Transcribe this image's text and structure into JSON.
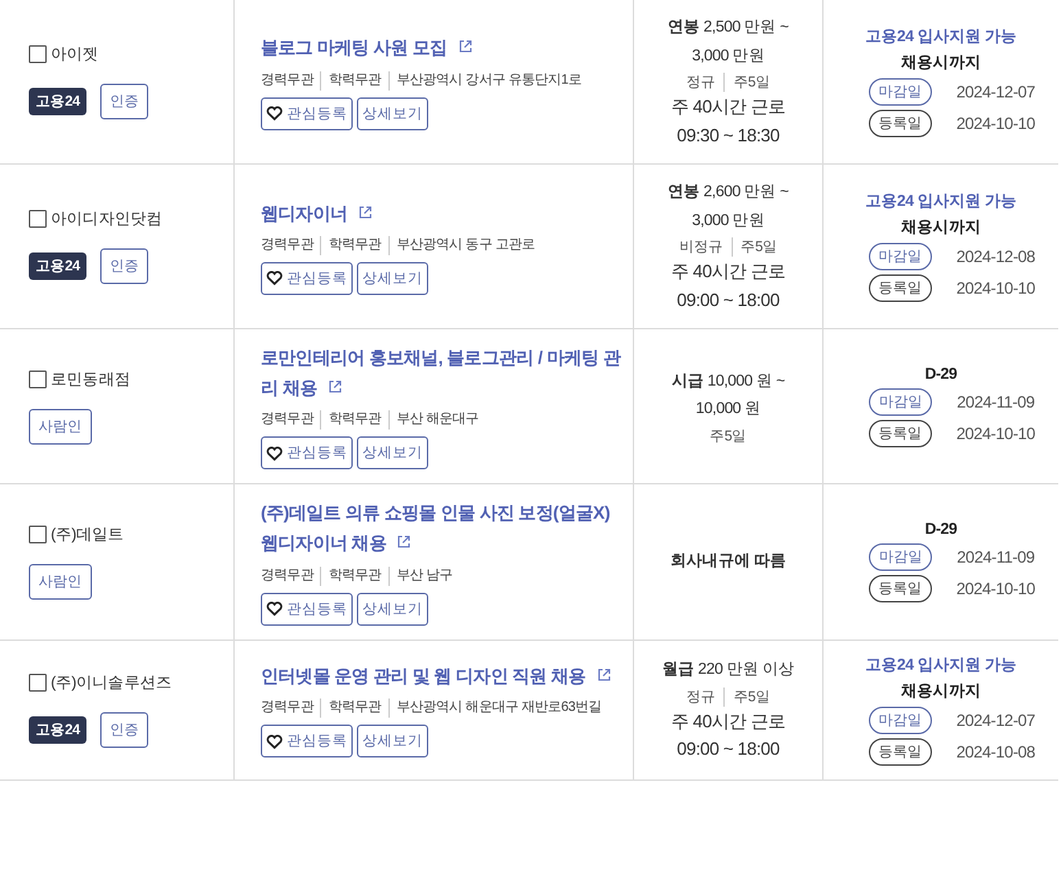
{
  "rows": [
    {
      "company": {
        "name": "아이젯",
        "checked": false
      },
      "badges": [
        {
          "kind": "goyong24",
          "label": "고용24"
        },
        {
          "kind": "outline",
          "label": "인증"
        }
      ],
      "title": "블로그 마케팅 사원 모집",
      "meta": [
        "경력무관",
        "학력무관",
        "부산광역시 강서구 유통단지1로"
      ],
      "buttons": [
        {
          "kind": "favorite",
          "label": "관심등록"
        },
        {
          "kind": "detail",
          "label": "상세보기"
        }
      ],
      "salary": "**연봉** 2,500 만원 ~ 3,000 만원",
      "terms": [
        "정규",
        "주5일"
      ],
      "hours": "주 40시간 근로",
      "time": "09:30 ~ 18:30",
      "apply": "고용24 입사지원 가능",
      "deadline": "채용시까지",
      "dates": [
        {
          "kind": "close",
          "label": "마감일",
          "date": "2024-12-07"
        },
        {
          "kind": "posted",
          "label": "등록일",
          "date": "2024-10-10"
        }
      ]
    },
    {
      "company": {
        "name": "아이디자인닷컴",
        "checked": false
      },
      "badges": [
        {
          "kind": "goyong24",
          "label": "고용24"
        },
        {
          "kind": "outline",
          "label": "인증"
        }
      ],
      "title": "웹디자이너",
      "meta": [
        "경력무관",
        "학력무관",
        "부산광역시 동구 고관로"
      ],
      "buttons": [
        {
          "kind": "favorite",
          "label": "관심등록"
        },
        {
          "kind": "detail",
          "label": "상세보기"
        }
      ],
      "salary": "**연봉** 2,600 만원 ~ 3,000 만원",
      "terms": [
        "비정규",
        "주5일"
      ],
      "hours": "주 40시간 근로",
      "time": "09:00 ~ 18:00",
      "apply": "고용24 입사지원 가능",
      "deadline": "채용시까지",
      "dates": [
        {
          "kind": "close",
          "label": "마감일",
          "date": "2024-12-08"
        },
        {
          "kind": "posted",
          "label": "등록일",
          "date": "2024-10-10"
        }
      ]
    },
    {
      "company": {
        "name": "로민동래점",
        "checked": false
      },
      "badges": [
        {
          "kind": "outline",
          "label": "사람인"
        }
      ],
      "title": "로만인테리어 홍보채널, 블로그관리 / 마케팅 관리 채용",
      "meta": [
        "경력무관",
        "학력무관",
        "부산 해운대구"
      ],
      "buttons": [
        {
          "kind": "favorite",
          "label": "관심등록"
        },
        {
          "kind": "detail",
          "label": "상세보기"
        }
      ],
      "salary": "**시급** 10,000 원 ~ 10,000 원",
      "terms": [
        "주5일"
      ],
      "deadline": "D-29",
      "dates": [
        {
          "kind": "close",
          "label": "마감일",
          "date": "2024-11-09"
        },
        {
          "kind": "posted",
          "label": "등록일",
          "date": "2024-10-10"
        }
      ]
    },
    {
      "company": {
        "name": "(주)데일트",
        "checked": false
      },
      "badges": [
        {
          "kind": "outline",
          "label": "사람인"
        }
      ],
      "title": "(주)데일트 의류 쇼핑몰 인물 사진 보정(얼굴X) 웹디자이너 채용",
      "meta": [
        "경력무관",
        "학력무관",
        "부산 남구"
      ],
      "buttons": [
        {
          "kind": "favorite",
          "label": "관심등록"
        },
        {
          "kind": "detail",
          "label": "상세보기"
        }
      ],
      "salary": "**회사내규에 따름**",
      "deadline": "D-29",
      "dates": [
        {
          "kind": "close",
          "label": "마감일",
          "date": "2024-11-09"
        },
        {
          "kind": "posted",
          "label": "등록일",
          "date": "2024-10-10"
        }
      ]
    },
    {
      "company": {
        "name": "(주)이니솔루션즈",
        "checked": false
      },
      "badges": [
        {
          "kind": "goyong24",
          "label": "고용24"
        },
        {
          "kind": "outline",
          "label": "인증"
        }
      ],
      "title": "인터넷몰 운영 관리 및 웹 디자인 직원 채용",
      "meta": [
        "경력무관",
        "학력무관",
        "부산광역시 해운대구 재반로63번길"
      ],
      "buttons": [
        {
          "kind": "favorite",
          "label": "관심등록"
        },
        {
          "kind": "detail",
          "label": "상세보기"
        }
      ],
      "salary": "**월급** 220 만원 이상",
      "terms": [
        "정규",
        "주5일"
      ],
      "hours": "주 40시간 근로",
      "time": "09:00 ~ 18:00",
      "apply": "고용24 입사지원 가능",
      "deadline": "채용시까지",
      "dates": [
        {
          "kind": "close",
          "label": "마감일",
          "date": "2024-12-07"
        },
        {
          "kind": "posted",
          "label": "등록일",
          "date": "2024-10-08"
        }
      ]
    }
  ]
}
